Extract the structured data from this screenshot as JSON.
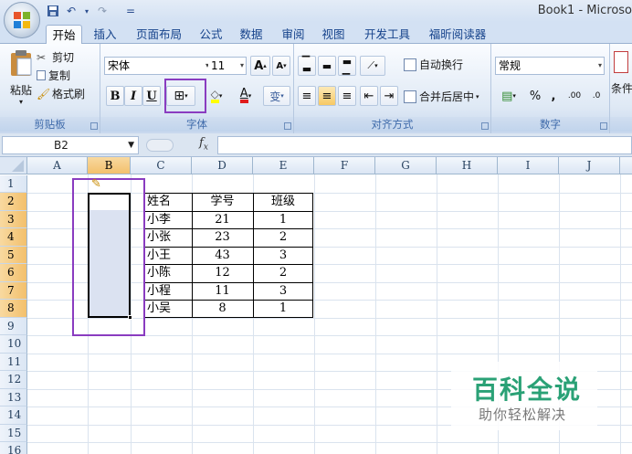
{
  "app": {
    "title": "Book1 - Microso"
  },
  "quick_access": {
    "save": "save-icon",
    "undo": "↶",
    "redo": "↷",
    "customize": "▾"
  },
  "tabs": [
    "开始",
    "插入",
    "页面布局",
    "公式",
    "数据",
    "审阅",
    "视图",
    "开发工具",
    "福昕阅读器"
  ],
  "clipboard": {
    "paste": "粘贴",
    "cut": "剪切",
    "copy": "复制",
    "format_painter": "格式刷",
    "label": "剪贴板"
  },
  "font": {
    "name": "宋体",
    "size": "11",
    "grow": "A",
    "shrink": "A",
    "bold": "B",
    "italic": "I",
    "underline": "U",
    "border": "⊞",
    "fill_color": "#ffff00",
    "font_color": "#e01c1c",
    "wen": "变",
    "label": "字体"
  },
  "alignment": {
    "wrap": "自动换行",
    "merge": "合并后居中",
    "label": "对齐方式"
  },
  "number": {
    "format": "常规",
    "percent": "%",
    "comma": ",",
    "inc_dec": ".00",
    "dec_dec": ".0",
    "label": "数字"
  },
  "styles": {
    "conditional": "条件"
  },
  "formula_bar": {
    "name_box": "B2",
    "fx": "fx",
    "value": ""
  },
  "sheet": {
    "columns": [
      "A",
      "B",
      "C",
      "D",
      "E",
      "F",
      "G",
      "H",
      "I",
      "J"
    ],
    "rows": [
      "1",
      "2",
      "3",
      "4",
      "5",
      "6",
      "7",
      "8",
      "9",
      "10",
      "11",
      "12",
      "13",
      "14",
      "15",
      "16"
    ],
    "header": [
      "姓名",
      "学号",
      "班级"
    ],
    "data": [
      [
        "小李",
        "21",
        "1"
      ],
      [
        "小张",
        "23",
        "2"
      ],
      [
        "小王",
        "43",
        "3"
      ],
      [
        "小陈",
        "12",
        "2"
      ],
      [
        "小程",
        "11",
        "3"
      ],
      [
        "小吴",
        "8",
        "1"
      ]
    ]
  },
  "watermark": {
    "title": "百科全说",
    "subtitle": "助你轻松解决"
  },
  "colors": {
    "selection_header": "#f3c06c",
    "highlight_box": "#8a3cc0",
    "watermark_green": "#2aa176"
  }
}
